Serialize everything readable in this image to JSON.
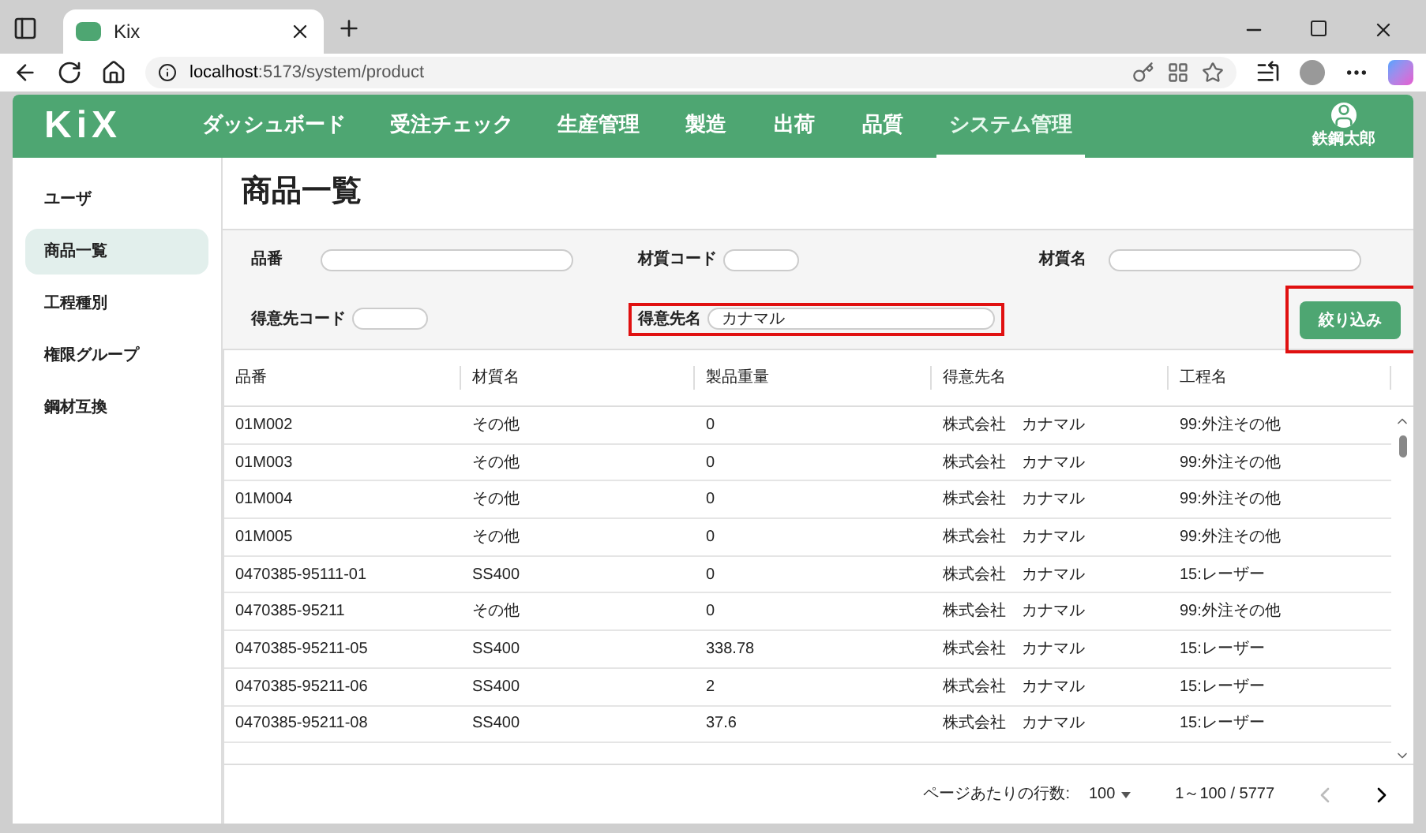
{
  "browser": {
    "tab_title": "Kix",
    "url_host": "localhost",
    "url_path": ":5173/system/product"
  },
  "app": {
    "logo": "KiX",
    "nav": [
      {
        "label": "ダッシュボード",
        "selected": false
      },
      {
        "label": "受注チェック",
        "selected": false
      },
      {
        "label": "生産管理",
        "selected": false
      },
      {
        "label": "製造",
        "selected": false
      },
      {
        "label": "出荷",
        "selected": false
      },
      {
        "label": "品質",
        "selected": false
      },
      {
        "label": "システム管理",
        "selected": true
      }
    ],
    "user": "鉄鋼太郎"
  },
  "sidebar": {
    "items": [
      {
        "label": "ユーザ",
        "selected": false
      },
      {
        "label": "商品一覧",
        "selected": true
      },
      {
        "label": "工程種別",
        "selected": false
      },
      {
        "label": "権限グループ",
        "selected": false
      },
      {
        "label": "鋼材互換",
        "selected": false
      }
    ]
  },
  "page_title": "商品一覧",
  "filters": [
    {
      "label": "品番",
      "highlighted": false
    },
    {
      "label": "材質コード",
      "highlighted": false
    },
    {
      "label": "材質名",
      "highlighted": false
    },
    {
      "label": "得意先コード",
      "highlighted": false
    },
    {
      "label": "得意先名",
      "value": "カナマル",
      "highlighted": true
    }
  ],
  "filter_button": {
    "label": "絞り込み",
    "highlighted": true
  },
  "table": {
    "columns": [
      "品番",
      "材質名",
      "製品重量",
      "得意先名",
      "工程名"
    ],
    "rows": [
      [
        "01M002",
        "その他",
        "0",
        "株式会社　カナマル",
        "99:外注その他"
      ],
      [
        "01M003",
        "その他",
        "0",
        "株式会社　カナマル",
        "99:外注その他"
      ],
      [
        "01M004",
        "その他",
        "0",
        "株式会社　カナマル",
        "99:外注その他"
      ],
      [
        "01M005",
        "その他",
        "0",
        "株式会社　カナマル",
        "99:外注その他"
      ],
      [
        "0470385-95111-01",
        "SS400",
        "0",
        "株式会社　カナマル",
        "15:レーザー"
      ],
      [
        "0470385-95211",
        "その他",
        "0",
        "株式会社　カナマル",
        "99:外注その他"
      ],
      [
        "0470385-95211-05",
        "SS400",
        "338.78",
        "株式会社　カナマル",
        "15:レーザー"
      ],
      [
        "0470385-95211-06",
        "SS400",
        "2",
        "株式会社　カナマル",
        "15:レーザー"
      ],
      [
        "0470385-95211-08",
        "SS400",
        "37.6",
        "株式会社　カナマル",
        "15:レーザー"
      ]
    ]
  },
  "pagination": {
    "rows_label": "ページあたりの行数:",
    "rows_per_page": "100",
    "range": "1～100 / 5777",
    "prev_disabled": true,
    "next_disabled": false
  }
}
